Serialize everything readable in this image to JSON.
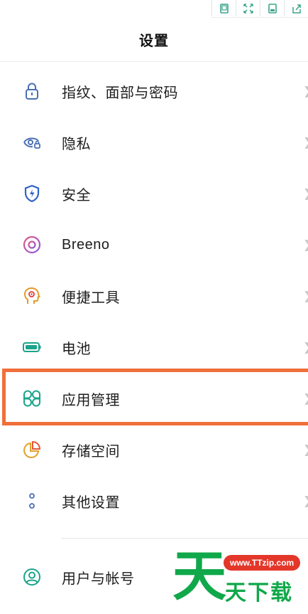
{
  "toolbar": {
    "icons": [
      "phone-frame-icon",
      "fullscreen-icon",
      "save-icon",
      "share-icon"
    ]
  },
  "header": {
    "title": "设置"
  },
  "settings": {
    "items": [
      {
        "label": "指纹、面部与密码",
        "icon": "lock-icon",
        "color": "#4a6fb5"
      },
      {
        "label": "隐私",
        "icon": "privacy-eye-icon",
        "color": "#4a6fb5"
      },
      {
        "label": "安全",
        "icon": "shield-icon",
        "color": "#2f63c6"
      },
      {
        "label": "Breeno",
        "icon": "breeno-icon",
        "color": "#c24aa1"
      },
      {
        "label": "便捷工具",
        "icon": "head-tool-icon",
        "color": "#e39a2a"
      },
      {
        "label": "电池",
        "icon": "battery-icon",
        "color": "#1aa48b"
      },
      {
        "label": "应用管理",
        "icon": "apps-grid-icon",
        "color": "#1aa48b"
      },
      {
        "label": "存储空间",
        "icon": "pie-storage-icon",
        "color": "#e3a12a"
      },
      {
        "label": "其他设置",
        "icon": "more-dots-icon",
        "color": "#4a6fb5"
      },
      {
        "label": "用户与帐号",
        "icon": "user-icon",
        "color": "#1aa48b"
      }
    ]
  },
  "highlight_color": "#f06f3a",
  "watermark": {
    "url": "www.TTzip.com",
    "logo_char": "天",
    "text": "天下载"
  }
}
